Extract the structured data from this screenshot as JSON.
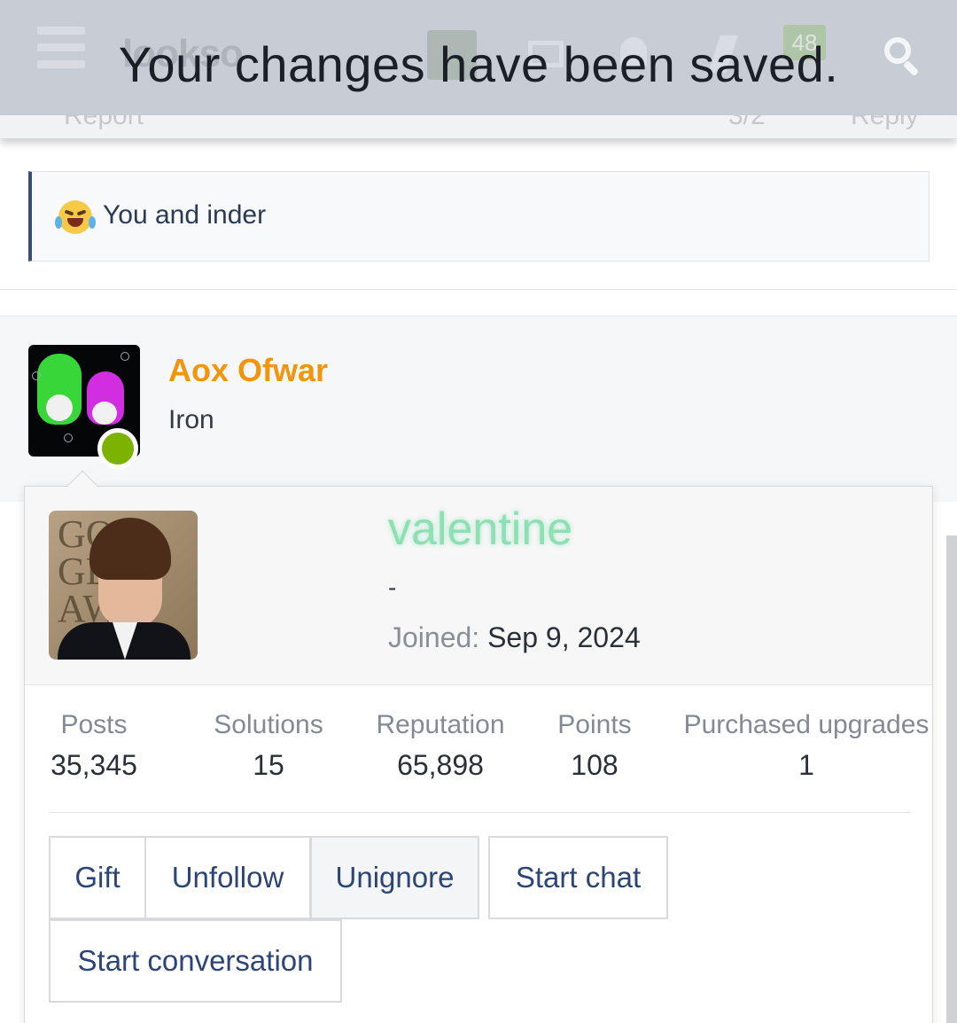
{
  "toast": {
    "message": "Your changes have been saved."
  },
  "header": {
    "notification_badge": "48"
  },
  "subbar": {
    "report_label": "Report",
    "counter": "3/2",
    "reply_label": "Reply"
  },
  "reactions": {
    "text": "You and inder"
  },
  "post": {
    "username": "Aox Ofwar",
    "rank": "Iron"
  },
  "profile_card": {
    "username": "valentine",
    "custom_title": "-",
    "joined_label": "Joined:",
    "joined_value": "Sep 9, 2024",
    "avatar_text": "GOLDEN GLOBE AWARDS",
    "stats": {
      "posts_label": "Posts",
      "posts_value": "35,345",
      "solutions_label": "Solutions",
      "solutions_value": "15",
      "reputation_label": "Reputation",
      "reputation_value": "65,898",
      "points_label": "Points",
      "points_value": "108",
      "upgrades_label": "Purchased upgrades",
      "upgrades_value": "1"
    },
    "actions": {
      "gift": "Gift",
      "unfollow": "Unfollow",
      "unignore": "Unignore",
      "start_chat": "Start chat",
      "start_conversation": "Start conversation"
    }
  },
  "colors": {
    "topbar": "#c8ccd5",
    "username_post": "#f0950c",
    "username_card": "#8ee0b4",
    "online": "#7cb300",
    "button_text": "#2d4477"
  }
}
